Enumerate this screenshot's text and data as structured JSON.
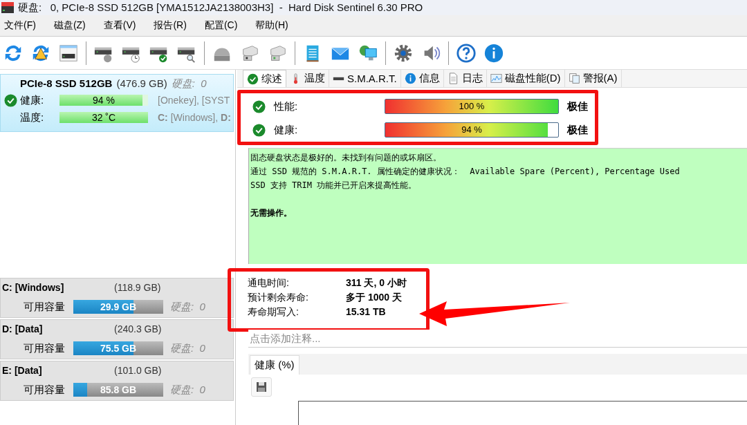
{
  "window": {
    "title": "硬盘:   0, PCIe-8 SSD 512GB [YMA1512JA2138003H3]  -  Hard Disk Sentinel 6.30 PRO"
  },
  "menu": [
    "文件(F)",
    "磁盘(Z)",
    "查看(V)",
    "报告(R)",
    "配置(C)",
    "帮助(H)"
  ],
  "disk": {
    "name": "PCIe-8 SSD 512GB",
    "size": "(476.9 GB)",
    "disk_label": "硬盘:  0",
    "selected": true,
    "rows": [
      {
        "label": "健康:",
        "ok": true,
        "reading": "94 %",
        "level": 0.94,
        "note": "[Onekey],  [SYST"
      },
      {
        "label": "温度:",
        "ok": false,
        "reading": "32 ˚C",
        "level": 1,
        "note": "**C:** [Windows], **D:**"
      }
    ]
  },
  "volumes": [
    {
      "name": "C: [Windows]",
      "size": "(118.9 GB)",
      "free_label": "可用容量",
      "free": "29.9 GB",
      "level": 0.67,
      "disk_label": "硬盘:  0"
    },
    {
      "name": "D: [Data]",
      "size": "(240.3 GB)",
      "free_label": "可用容量",
      "free": "75.5 GB",
      "level": 0.67,
      "disk_label": "硬盘:  0"
    },
    {
      "name": "E: [Data]",
      "size": "(101.0 GB)",
      "free_label": "可用容量",
      "free": "85.8 GB",
      "level": 0.15,
      "disk_label": "硬盘:  0"
    }
  ],
  "tabs": [
    {
      "label": "综述",
      "selected": true
    },
    {
      "label": "温度",
      "selected": false
    },
    {
      "label": "S.M.A.R.T.",
      "selected": false
    },
    {
      "label": "信息",
      "selected": false
    },
    {
      "label": "日志",
      "selected": false
    },
    {
      "label": "磁盘性能(D)",
      "selected": false
    },
    {
      "label": "警报(A)",
      "selected": false
    }
  ],
  "status": {
    "highlighted": true,
    "rows": [
      {
        "label": "性能:",
        "ok": true,
        "reading": "100 %",
        "level": 1,
        "rating": "极佳"
      },
      {
        "label": "健康:",
        "ok": true,
        "reading": "94 %",
        "level": 0.94,
        "rating": "极佳"
      }
    ]
  },
  "description": {
    "lines": [
      "固态硬盘状态是极好的。未找到有问题的或坏扇区。",
      "通过 SSD 规范的 S.M.A.R.T. 属性确定的健康状况：  Available Spare (Percent), Percentage Used",
      "SSD 支持 TRIM 功能并已开启来提高性能。"
    ],
    "action": "无需操作。"
  },
  "info": {
    "highlighted": true,
    "pointer": true,
    "rows": [
      {
        "label": "通电时间:",
        "value": "311 天, 0 小时"
      },
      {
        "label": "预计剩余寿命:",
        "value": "多于 1000 天"
      },
      {
        "label": "寿命期写入:",
        "value": "15.31 TB"
      }
    ]
  },
  "note_field": {
    "placeholder": "点击添加注释..."
  },
  "chart_tabs": [
    {
      "label": "健康 (%)",
      "selected": true
    }
  ]
}
